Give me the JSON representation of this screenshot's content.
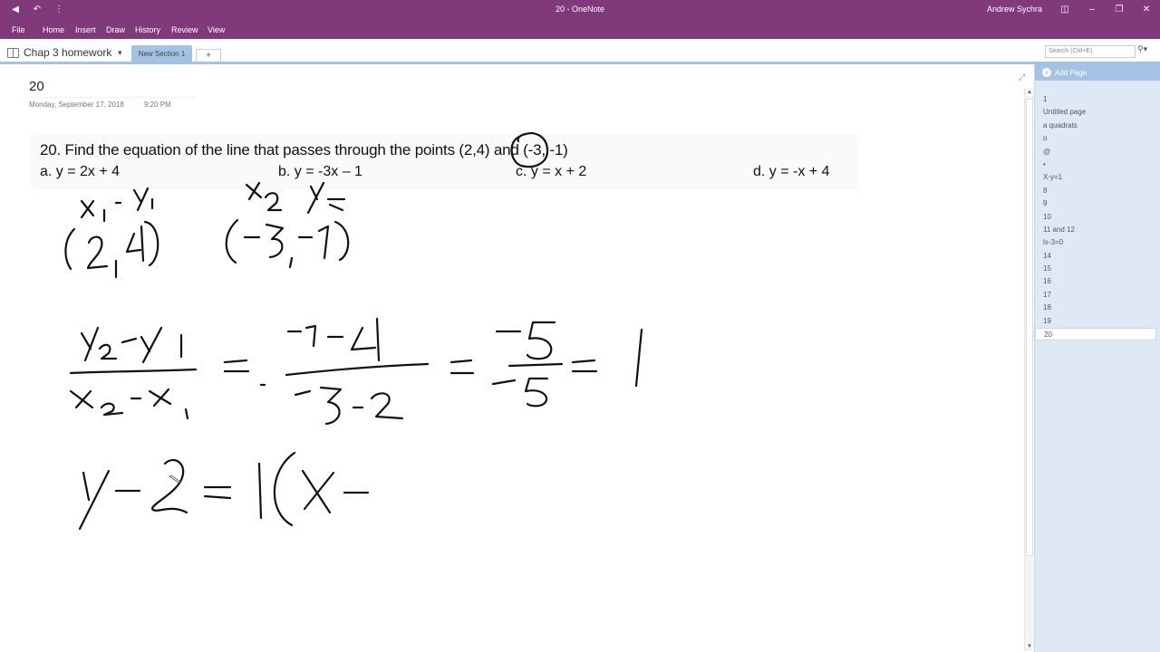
{
  "window": {
    "title": "20  -  OneNote",
    "user": "Andrew Sychra",
    "qat_icons": [
      "back-icon",
      "undo-icon",
      "customize-qat-icon"
    ],
    "controls": [
      "ribbon-display-icon",
      "minimize-icon",
      "restore-icon",
      "close-icon"
    ]
  },
  "ribbon": {
    "tabs": [
      "File",
      "Home",
      "Insert",
      "Draw",
      "History",
      "Review",
      "View"
    ]
  },
  "notebook": {
    "name": "Chap 3 homework",
    "active_section": "New Section 1",
    "add_section": "+"
  },
  "search": {
    "placeholder": "Search (Ctrl+E)"
  },
  "page": {
    "title": "20",
    "date": "Monday, September 17, 2018",
    "time": "9:20 PM",
    "question": "20.  Find the equation of the line that passes through the points (2,4) and (-3, -1)",
    "options": [
      "a.  y = 2x + 4",
      "b.  y = -3x – 1",
      "c.  y = x + 2",
      "d.  y = -x + 4"
    ],
    "handwriting": {
      "labels_point1": "x1  y1",
      "point1": "(2, 4)",
      "labels_point2": "x2  y2",
      "point2": "(-3, -1)",
      "slope_work": "(y2 - y1)/(x2 - x1) = (-1 - 4)/(-3 - 2) = -5/-5 = 1",
      "point_slope": "y - 2 = 1(x -"
    }
  },
  "pages_pane": {
    "add_page": "Add Page",
    "pages": [
      "1",
      "Untitled page",
      "a quadrats",
      "o",
      "@",
      "•",
      "X-y=1",
      "8",
      "9",
      "10",
      "11 and 12",
      "lx-3=0",
      "14",
      "15",
      "16",
      "17",
      "18",
      "19",
      "20"
    ],
    "active_page": "20"
  }
}
